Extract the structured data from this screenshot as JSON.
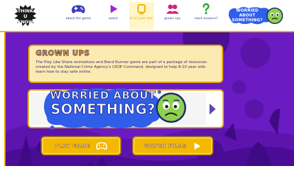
{
  "nav": {
    "logo_lines": [
      "THINK",
      "U",
      "KNOW"
    ],
    "items": [
      {
        "label": "about the game",
        "icon": "gamepad-icon",
        "active": false
      },
      {
        "label": "watch",
        "icon": "play-icon",
        "active": false
      },
      {
        "label": "8-10 year olds",
        "icon": "square-icon",
        "active": true
      },
      {
        "label": "grown ups",
        "icon": "people-icon",
        "active": false
      },
      {
        "label": "need answers?",
        "icon": "question-icon",
        "active": false
      }
    ],
    "badge_text": "WORRIED ABOUT SOMETHING?"
  },
  "info_card": {
    "title": "GROWN UPS",
    "body": "The Play Like Share animations and Band Runner game are part of a package of resources created by the National Crime Agency's CEOP Command, designed to help 8-10 year olds learn how to stay safe online."
  },
  "carousel": {
    "line1": "WORRIED ABOUT",
    "line2": "SOMETHING?"
  },
  "buttons": {
    "play_label": "PLAY GAME",
    "watch_label": "WATCH FILMS"
  },
  "colors": {
    "stage_purple": "#6f1dc5",
    "accent_yellow": "#f2b400",
    "nav_text_blue": "#3a3aa8",
    "card_bg": "#fcebb0",
    "face_green": "#8fd14f",
    "splash_blue": "#2f5fe8"
  }
}
